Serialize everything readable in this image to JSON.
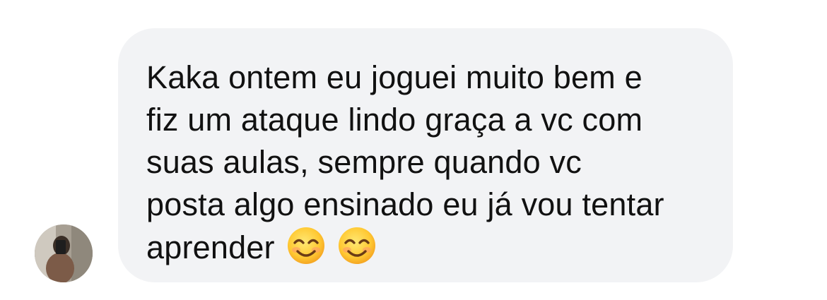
{
  "message": {
    "text_lines": "Kaka ontem eu joguei muito bem e\nfiz um ataque lindo graça a vc com\nsuas aulas, sempre quando vc\nposta algo ensinado eu já vou tentar\naprender",
    "emojis": [
      "smiling-face-with-smiling-eyes",
      "smiling-face-with-smiling-eyes"
    ]
  },
  "colors": {
    "bubble": "#f2f3f5",
    "text": "#111111",
    "background": "#ffffff"
  }
}
